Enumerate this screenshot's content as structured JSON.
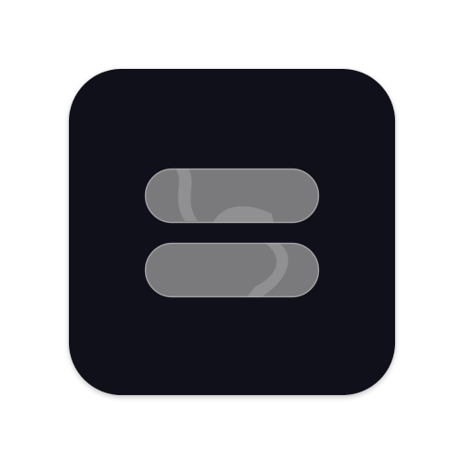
{
  "app_icon": {
    "icon_name": "equals-icon",
    "colors": {
      "tile": "#0f1019",
      "bar_fill": "#7a7a7c",
      "bar_highlight": "#9a9a9c",
      "bar_border": "#b0b0b2",
      "background": "#ffffff"
    }
  }
}
